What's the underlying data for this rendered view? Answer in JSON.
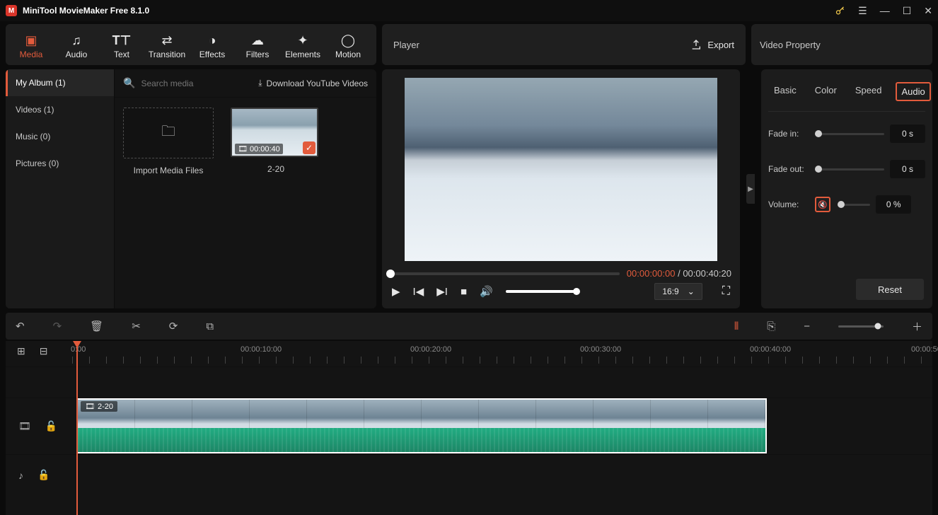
{
  "app": {
    "title": "MiniTool MovieMaker Free 8.1.0"
  },
  "tabs": {
    "media": "Media",
    "audio": "Audio",
    "text": "Text",
    "transition": "Transition",
    "effects": "Effects",
    "filters": "Filters",
    "elements": "Elements",
    "motion": "Motion"
  },
  "player": {
    "label": "Player",
    "export": "Export",
    "cur_time": "00:00:00:00",
    "total_time": "00:00:40:20",
    "aspect": "16:9"
  },
  "property": {
    "title": "Video Property",
    "tabs": {
      "basic": "Basic",
      "color": "Color",
      "speed": "Speed",
      "audio": "Audio"
    },
    "fade_in_label": "Fade in:",
    "fade_in_val": "0 s",
    "fade_out_label": "Fade out:",
    "fade_out_val": "0 s",
    "volume_label": "Volume:",
    "volume_val": "0 %",
    "reset": "Reset"
  },
  "library": {
    "cats": {
      "myalbum": "My Album (1)",
      "videos": "Videos (1)",
      "music": "Music (0)",
      "pictures": "Pictures (0)"
    },
    "search_placeholder": "Search media",
    "download_yt": "Download YouTube Videos",
    "import_label": "Import Media Files",
    "clip": {
      "duration": "00:00:40",
      "name": "2-20"
    }
  },
  "timeline": {
    "marks": [
      "0:00",
      "00:00:10:00",
      "00:00:20:00",
      "00:00:30:00",
      "00:00:40:00",
      "00:00:50"
    ],
    "clip_name": "2-20"
  }
}
